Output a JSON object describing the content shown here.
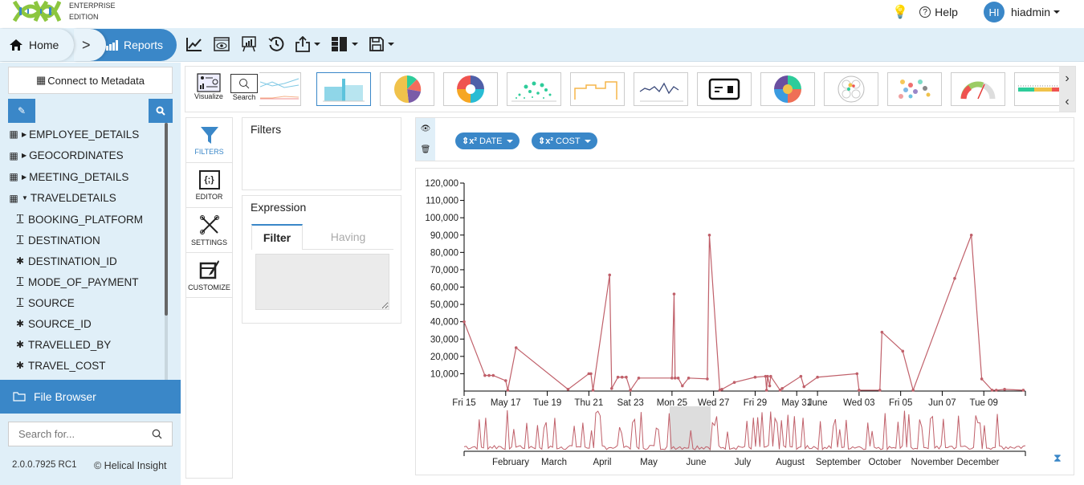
{
  "header": {
    "edition_line1": "ENTERPRISE",
    "edition_line2": "EDITION",
    "help_label": "Help",
    "avatar_initials": "HI",
    "username": "hiadmin"
  },
  "breadcrumb": {
    "home_label": "Home",
    "reports_label": "Reports"
  },
  "toolbar_icons": [
    "line-chart-icon",
    "preview-icon",
    "presentation-icon",
    "history-icon",
    "share-icon",
    "layout-icon",
    "save-icon"
  ],
  "sidebar": {
    "connect_label": "Connect to Metadata",
    "tables": [
      {
        "label": "EMPLOYEE_DETAILS",
        "expanded": false
      },
      {
        "label": "GEOCORDINATES",
        "expanded": false
      },
      {
        "label": "MEETING_DETAILS",
        "expanded": false
      },
      {
        "label": "TRAVELDETAILS",
        "expanded": true
      }
    ],
    "columns": [
      {
        "label": "BOOKING_PLATFORM",
        "type": "text"
      },
      {
        "label": "DESTINATION",
        "type": "text"
      },
      {
        "label": "DESTINATION_ID",
        "type": "numeric"
      },
      {
        "label": "MODE_OF_PAYMENT",
        "type": "text"
      },
      {
        "label": "SOURCE",
        "type": "text"
      },
      {
        "label": "SOURCE_ID",
        "type": "numeric"
      },
      {
        "label": "TRAVELLED_BY",
        "type": "numeric"
      },
      {
        "label": "TRAVEL_COST",
        "type": "numeric"
      }
    ],
    "file_browser_label": "File Browser",
    "search_placeholder": "Search for...",
    "version": "2.0.0.7925 RC1",
    "copyright": "© Helical Insight"
  },
  "visualization_strip": {
    "visualize_label": "Visualize",
    "search_label": "Search",
    "chart_types": [
      "multi-line",
      "area-bar",
      "pie",
      "donut",
      "scatter",
      "step",
      "line",
      "card",
      "sunburst",
      "pack",
      "bubble",
      "gauge",
      "bullet"
    ],
    "active": "area-bar"
  },
  "left_tabs": [
    {
      "label": "FILTERS",
      "icon": "filter-icon",
      "active": true
    },
    {
      "label": "EDITOR",
      "icon": "code-icon",
      "active": false
    },
    {
      "label": "SETTINGS",
      "icon": "tools-icon",
      "active": false
    },
    {
      "label": "CUSTOMIZE",
      "icon": "brush-icon",
      "active": false
    }
  ],
  "filters_panel": {
    "title": "Filters"
  },
  "expression_panel": {
    "title": "Expression",
    "tab_filter": "Filter",
    "tab_having": "Having"
  },
  "fields": [
    {
      "label": "DATE",
      "prefix": "⇕x²"
    },
    {
      "label": "COST",
      "prefix": "⇕x²"
    }
  ],
  "chart_data": {
    "type": "line",
    "title": "",
    "xlabel": "",
    "ylabel": "",
    "ylim": [
      0,
      120000
    ],
    "y_ticks": [
      "10,000",
      "20,000",
      "30,000",
      "40,000",
      "50,000",
      "60,000",
      "70,000",
      "80,000",
      "90,000",
      "100,000",
      "110,000",
      "120,000"
    ],
    "y_tick_values": [
      10000,
      20000,
      30000,
      40000,
      50000,
      60000,
      70000,
      80000,
      90000,
      100000,
      110000,
      120000
    ],
    "x_ticks": [
      "Fri 15",
      "May 17",
      "Tue 19",
      "Thu 21",
      "Sat 23",
      "Mon 25",
      "Wed 27",
      "Fri 29",
      "May 31",
      "June",
      "Wed 03",
      "Fri 05",
      "Jun 07",
      "Tue 09"
    ],
    "x_tick_positions": [
      0,
      2,
      4,
      6,
      8,
      10,
      12,
      14,
      16,
      17,
      19,
      21,
      23,
      25
    ],
    "xlim": [
      0,
      27
    ],
    "series": [
      {
        "name": "COST",
        "color": "#c0606a",
        "x": [
          0,
          1.0,
          1.2,
          1.4,
          2.0,
          2.1,
          2.5,
          5.0,
          6.0,
          6.1,
          6.2,
          7.0,
          7.1,
          7.4,
          7.6,
          7.8,
          8.0,
          8.4,
          10.0,
          10.1,
          10.15,
          10.3,
          10.5,
          10.8,
          11.7,
          11.8,
          12.3,
          12.4,
          13.0,
          14.0,
          14.5,
          14.55,
          14.6,
          14.7,
          14.75,
          15.2,
          15.3,
          16.2,
          16.35,
          17.0,
          18.9,
          19.0,
          20.0,
          20.1,
          21.1,
          21.6,
          23.6,
          24.4,
          24.9,
          25.4,
          25.6,
          26.0,
          26.9
        ],
        "y": [
          40000,
          9000,
          9000,
          9000,
          6000,
          500,
          25000,
          1000,
          10000,
          10000,
          500,
          67000,
          1500,
          8000,
          8000,
          8000,
          500,
          7500,
          7500,
          56000,
          7500,
          7500,
          3000,
          7500,
          7000,
          90000,
          500,
          1000,
          5000,
          8000,
          8500,
          500,
          8500,
          3000,
          8500,
          500,
          1500,
          8500,
          2500,
          8000,
          10000,
          500,
          500,
          34000,
          23000,
          500,
          65000,
          90000,
          7000,
          500,
          500,
          1000,
          500
        ]
      }
    ],
    "navigator": {
      "months": [
        "February",
        "March",
        "April",
        "May",
        "June",
        "July",
        "August",
        "September",
        "October",
        "November",
        "December"
      ],
      "selected_range": [
        "Fri 15",
        "Tue 09"
      ]
    }
  }
}
